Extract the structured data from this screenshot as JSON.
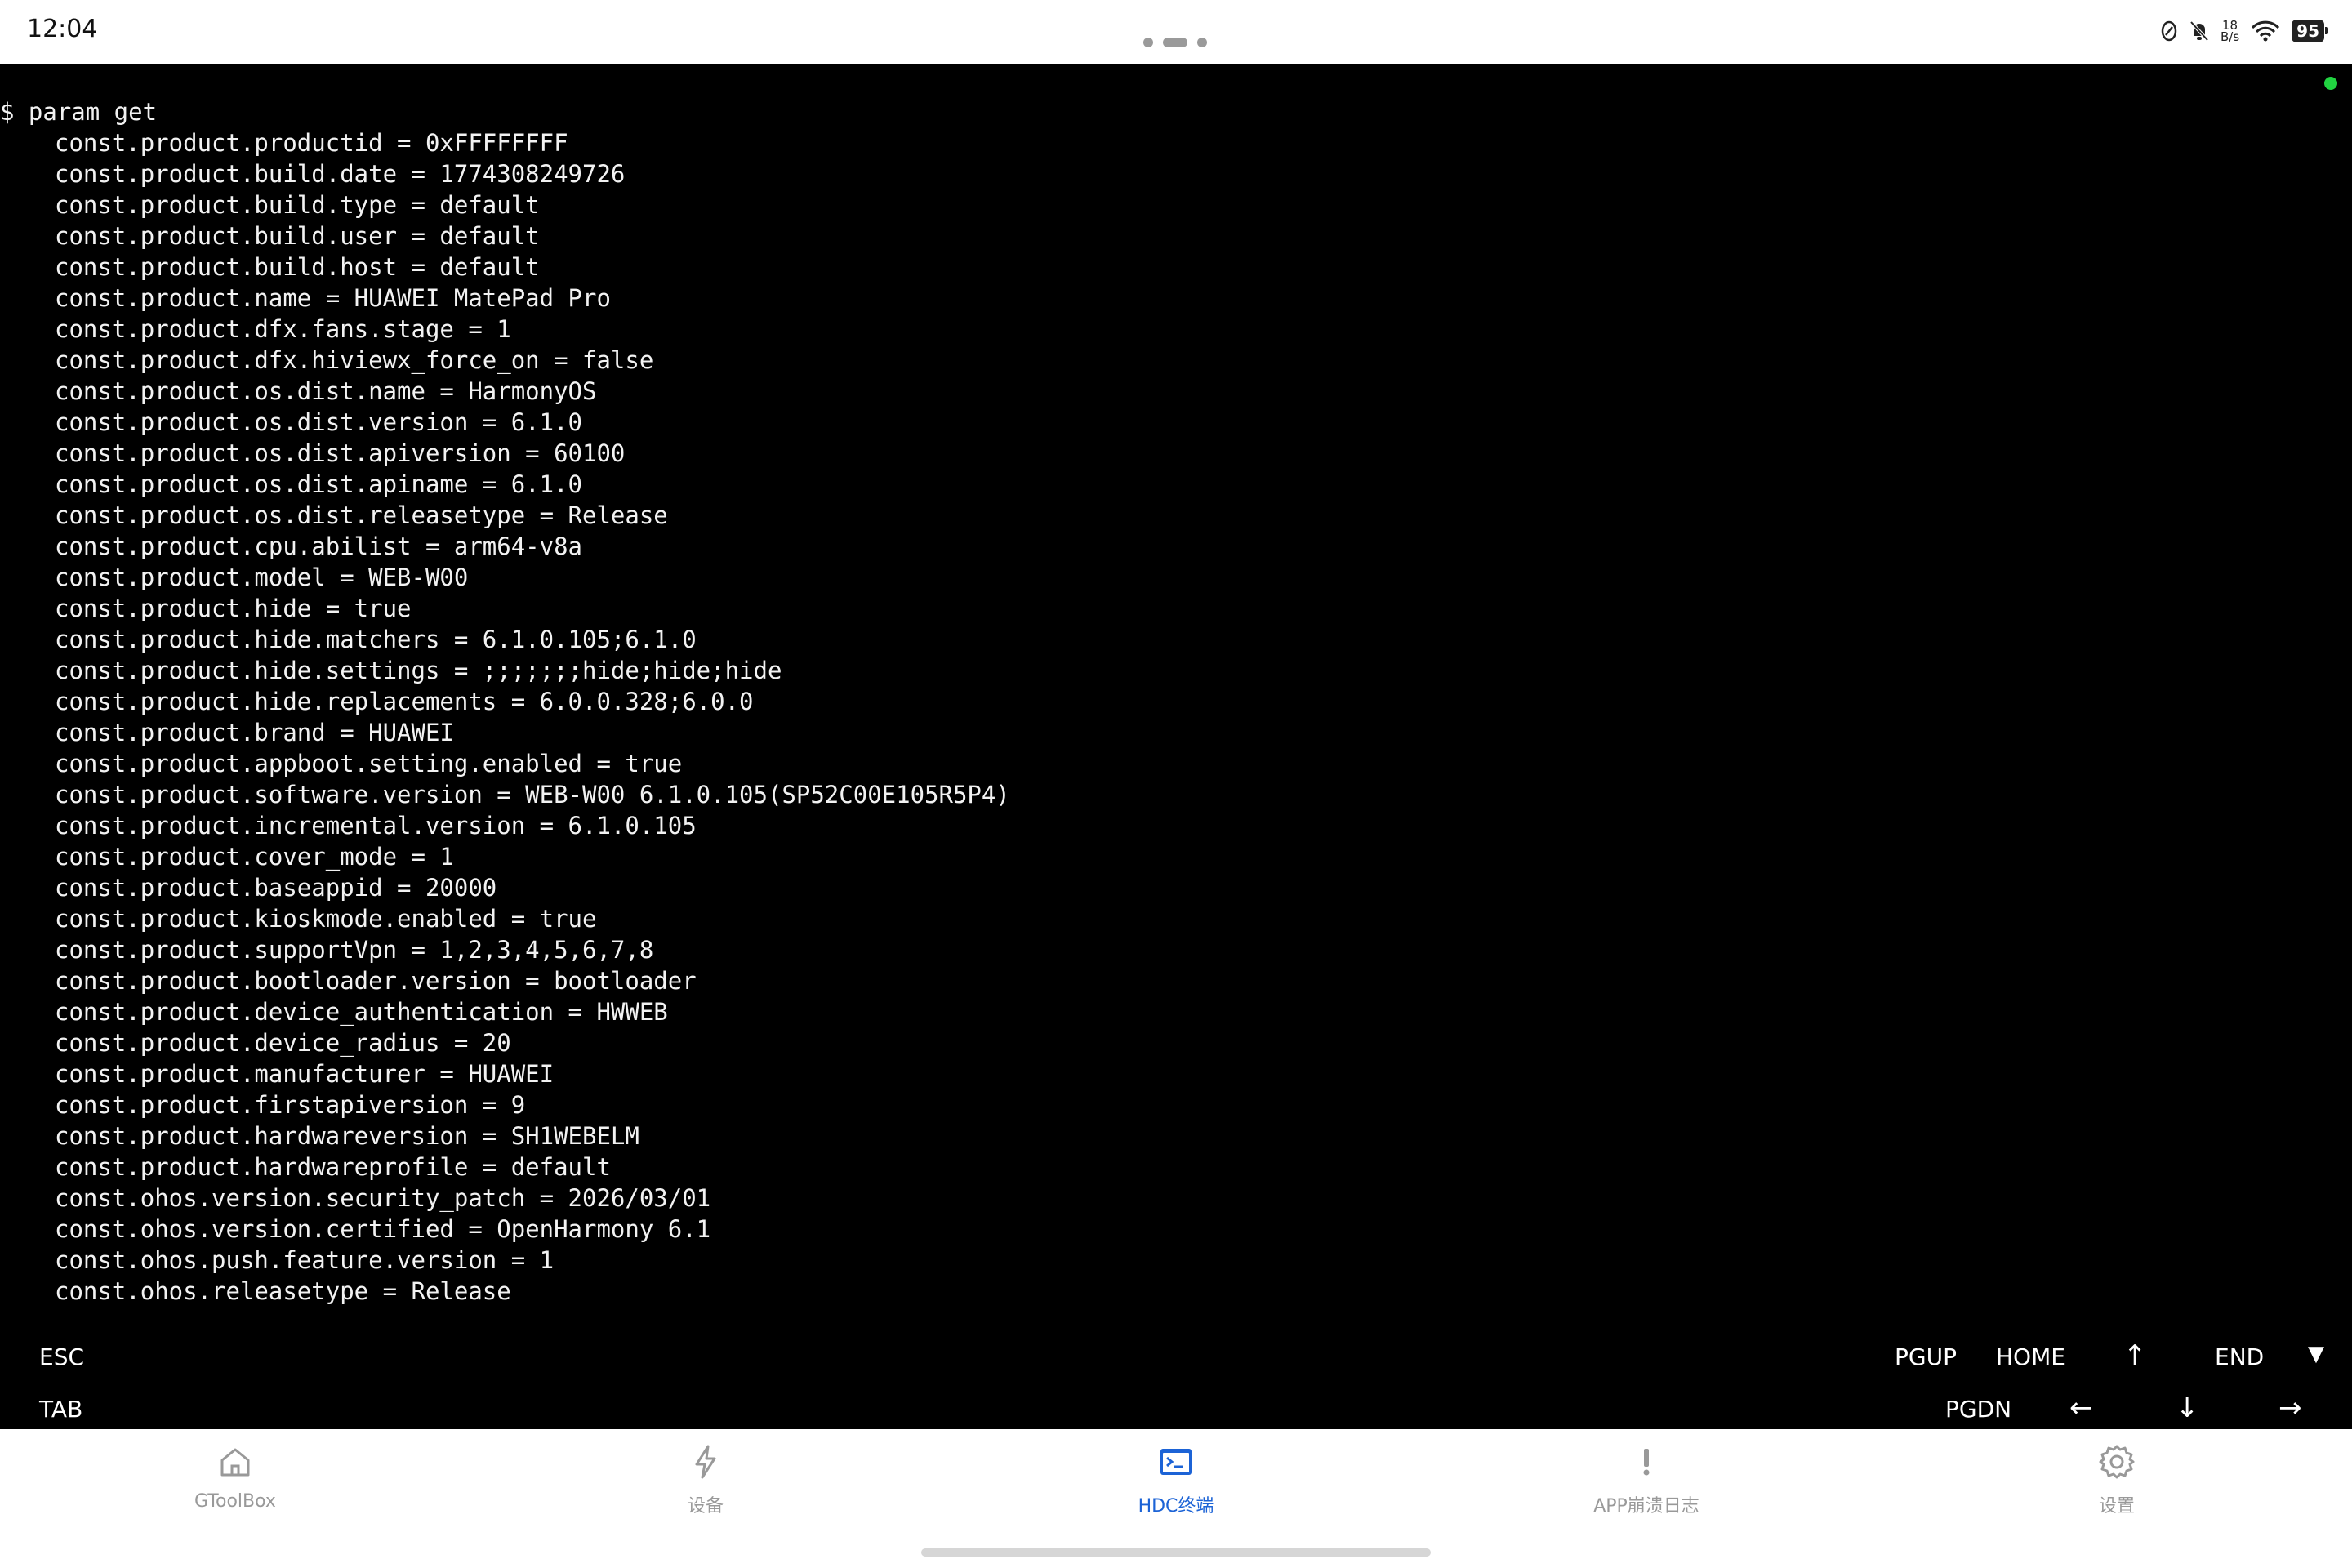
{
  "status_bar": {
    "time": "12:04",
    "net_speed_value": "18",
    "net_speed_unit": "B/s",
    "battery": "95"
  },
  "terminal": {
    "command": "$ param get",
    "output": [
      "const.product.productid = 0xFFFFFFFF",
      "const.product.build.date = 1774308249726",
      "const.product.build.type = default",
      "const.product.build.user = default",
      "const.product.build.host = default",
      "const.product.name = HUAWEI MatePad Pro",
      "const.product.dfx.fans.stage = 1",
      "const.product.dfx.hiviewx_force_on = false",
      "const.product.os.dist.name = HarmonyOS",
      "const.product.os.dist.version = 6.1.0",
      "const.product.os.dist.apiversion = 60100",
      "const.product.os.dist.apiname = 6.1.0",
      "const.product.os.dist.releasetype = Release",
      "const.product.cpu.abilist = arm64-v8a",
      "const.product.model = WEB-W00",
      "const.product.hide = true",
      "const.product.hide.matchers = 6.1.0.105;6.1.0",
      "const.product.hide.settings = ;;;;;;;hide;hide;hide",
      "const.product.hide.replacements = 6.0.0.328;6.0.0",
      "const.product.brand = HUAWEI",
      "const.product.appboot.setting.enabled = true",
      "const.product.software.version = WEB-W00 6.1.0.105(SP52C00E105R5P4)",
      "const.product.incremental.version = 6.1.0.105",
      "const.product.cover_mode = 1",
      "const.product.baseappid = 20000",
      "const.product.kioskmode.enabled = true",
      "const.product.supportVpn = 1,2,3,4,5,6,7,8",
      "const.product.bootloader.version = bootloader",
      "const.product.device_authentication = HWWEB",
      "const.product.device_radius = 20",
      "const.product.manufacturer = HUAWEI",
      "const.product.firstapiversion = 9",
      "const.product.hardwareversion = SH1WEBELM",
      "const.product.hardwareprofile = default",
      "const.ohos.version.security_patch = 2026/03/01",
      "const.ohos.version.certified = OpenHarmony 6.1",
      "const.ohos.push.feature.version = 1",
      "const.ohos.releasetype = Release"
    ]
  },
  "keys": {
    "esc": "ESC",
    "tab": "TAB",
    "pgup": "PGUP",
    "home": "HOME",
    "up": "↑",
    "end": "END",
    "collapse": "▼",
    "pgdn": "PGDN",
    "left": "←",
    "down": "↓",
    "right": "→"
  },
  "nav": {
    "items": [
      {
        "label": "GToolBox",
        "icon": "home-icon"
      },
      {
        "label": "设备",
        "icon": "lightning-icon"
      },
      {
        "label": "HDC终端",
        "icon": "terminal-icon"
      },
      {
        "label": "APP崩溃日志",
        "icon": "exclamation-icon"
      },
      {
        "label": "设置",
        "icon": "gear-icon"
      }
    ],
    "active_index": 2,
    "active_color": "#1c63d6",
    "inactive_color": "#999999"
  },
  "colors": {
    "terminal_bg": "#000000",
    "terminal_fg": "#f2f2f2",
    "connection_indicator": "#21d341"
  }
}
